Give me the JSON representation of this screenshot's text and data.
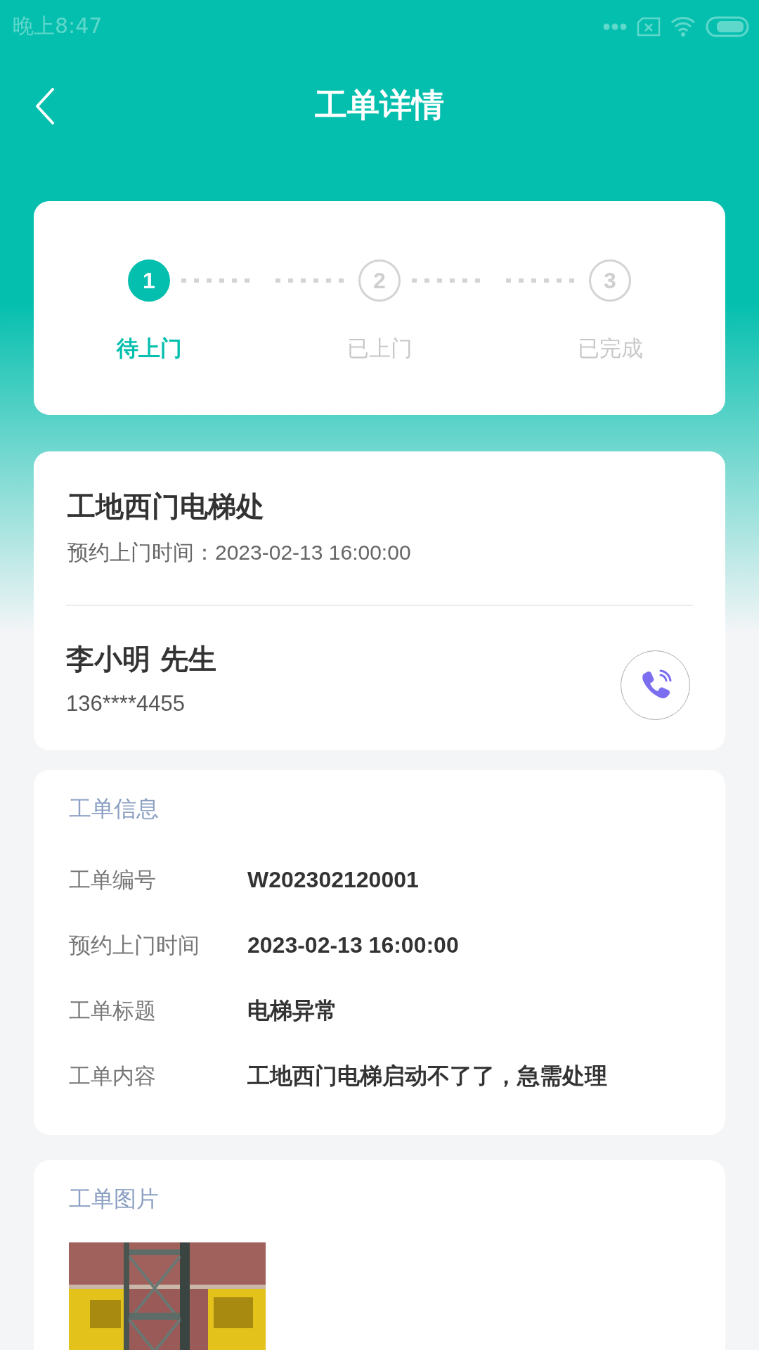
{
  "status_bar": {
    "time": "晚上8:47"
  },
  "header": {
    "title": "工单详情"
  },
  "steps": [
    {
      "number": "1",
      "label": "待上门",
      "selected": true
    },
    {
      "number": "2",
      "label": "已上门",
      "selected": false
    },
    {
      "number": "3",
      "label": "已完成",
      "selected": false
    }
  ],
  "summary": {
    "location": "工地西门电梯处",
    "appointment": "预约上门时间：2023-02-13 16:00:00",
    "contact_name": "李小明 先生",
    "phone": "136****4455"
  },
  "info": {
    "heading": "工单信息",
    "rows": [
      {
        "label": "工单编号",
        "value": "W202302120001"
      },
      {
        "label": "预约上门时间",
        "value": "2023-02-13 16:00:00"
      },
      {
        "label": "工单标题",
        "value": "电梯异常"
      },
      {
        "label": "工单内容",
        "value": "工地西门电梯启动不了了，急需处理"
      }
    ]
  },
  "photos": {
    "heading": "工单图片"
  }
}
